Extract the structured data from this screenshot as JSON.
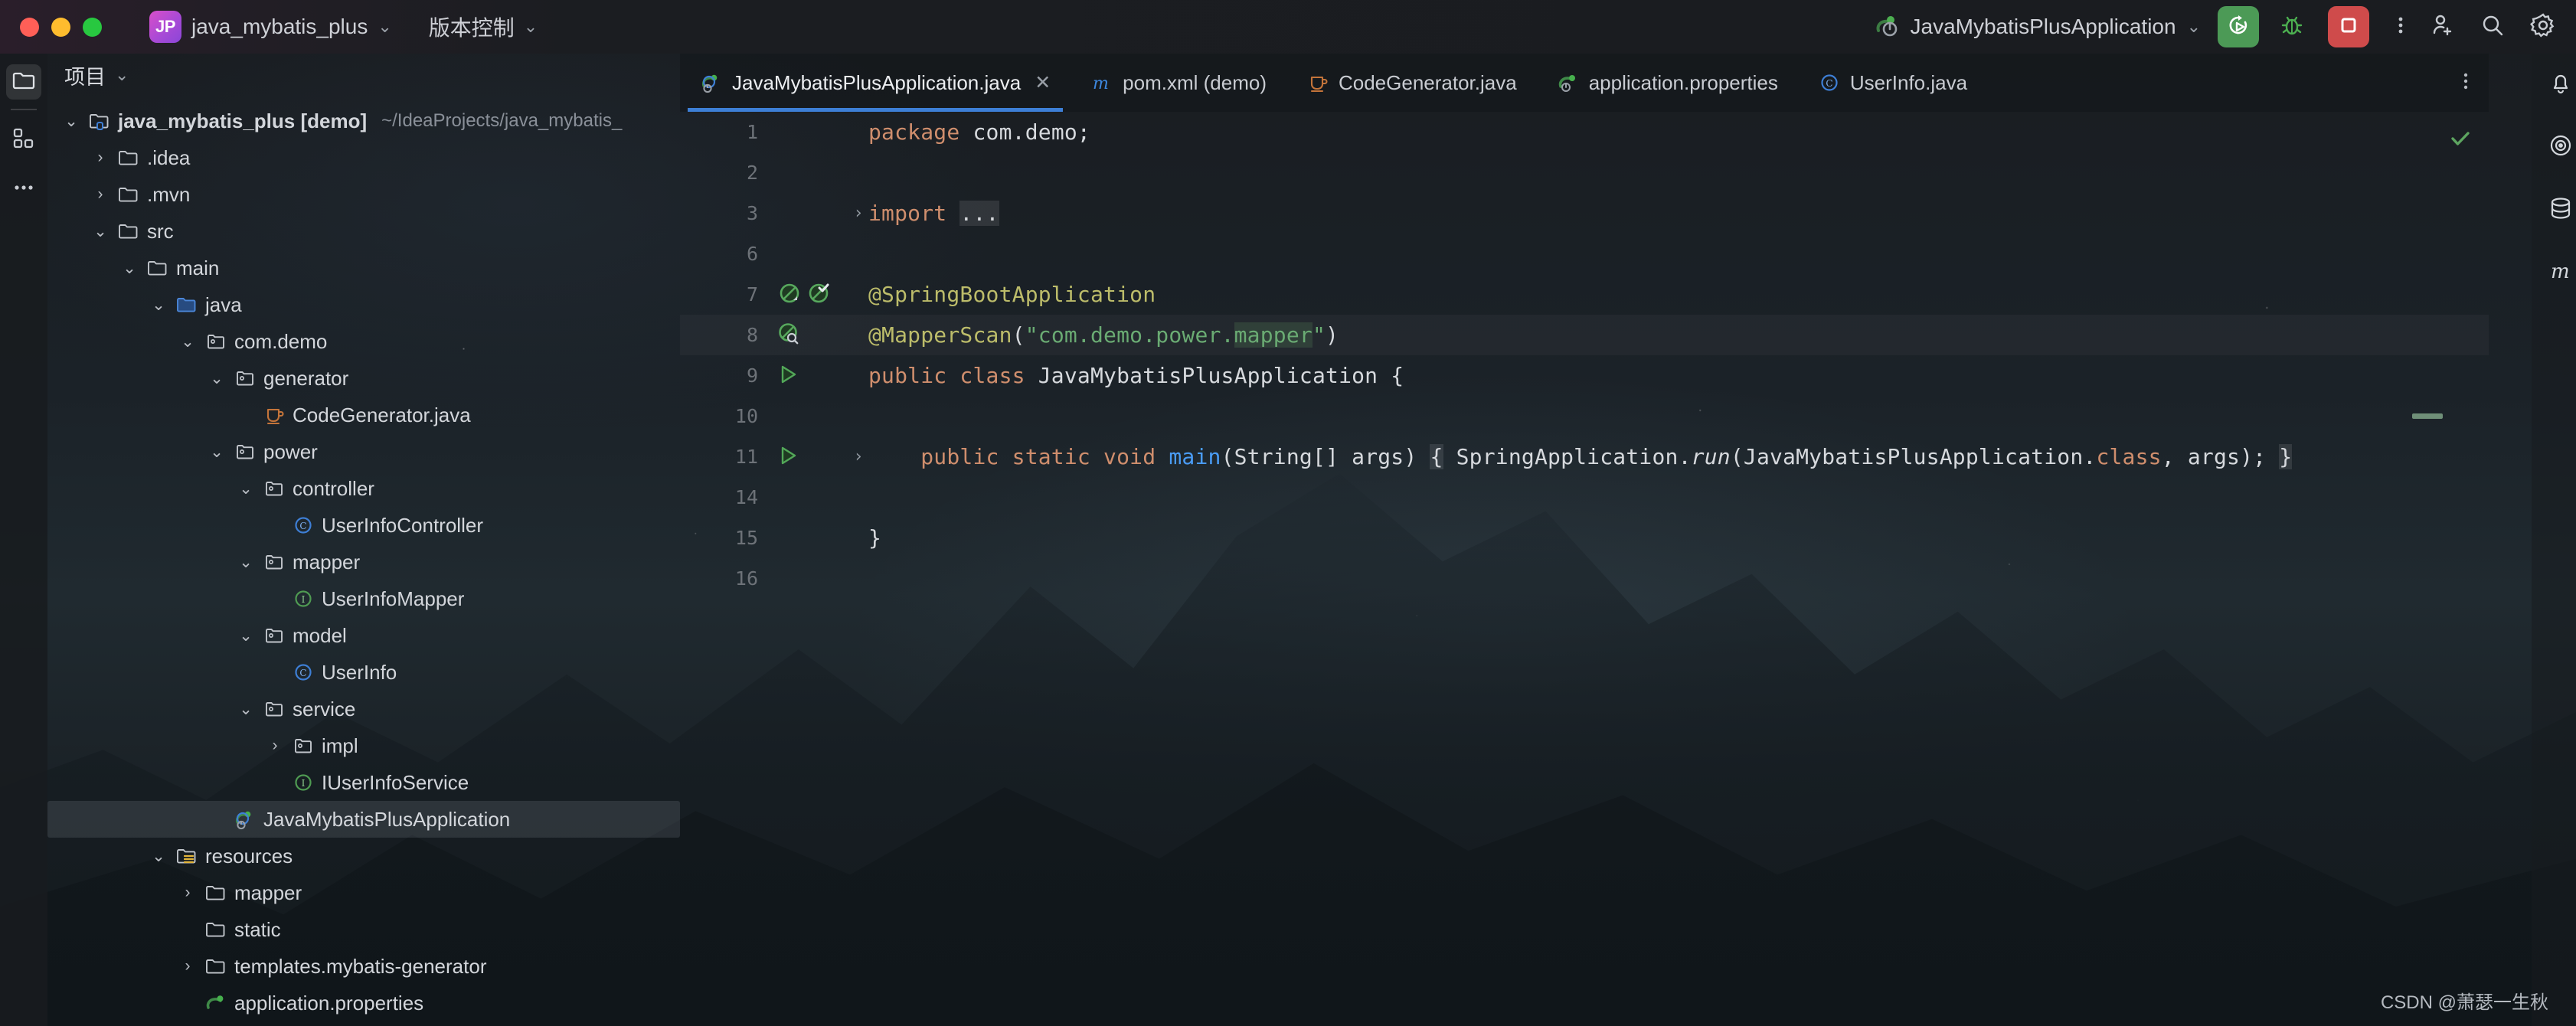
{
  "titlebar": {
    "project_badge": "JP",
    "project_name": "java_mybatis_plus",
    "project_chevron": "⌄",
    "vcs_label": "版本控制",
    "vcs_chevron": "⌄",
    "run_config_name": "JavaMybatisPlusApplication",
    "run_config_chevron": "⌄",
    "icons": {
      "run": "run-icon",
      "debug": "bug-icon",
      "stop": "stop-icon",
      "more": "more-vertical-icon",
      "add_user": "add-user-icon",
      "search": "search-icon",
      "settings": "gear-icon"
    },
    "accent_run_bg": "#4c9a56",
    "accent_stop_bg": "#cf4b4b",
    "accent_badge_bg": "#a94ad6"
  },
  "left_strip": {
    "items": [
      {
        "name": "project-tool-window",
        "icon": "folder-icon",
        "active": true
      },
      {
        "name": "commit-tool-window",
        "icon": "grid-squares-icon",
        "active": false
      },
      {
        "name": "more-tool-windows",
        "icon": "more-horizontal-icon",
        "active": false
      }
    ]
  },
  "project_panel": {
    "title": "项目",
    "title_chevron": "⌄",
    "tree": [
      {
        "label": "java_mybatis_plus [demo]",
        "path": "~/IdeaProjects/java_mybatis_",
        "depth": 0,
        "arrow": "⌄",
        "icon": "module-folder-icon",
        "bold": true,
        "selected": false
      },
      {
        "label": ".idea",
        "depth": 1,
        "arrow": "›",
        "icon": "folder-icon",
        "selected": false
      },
      {
        "label": ".mvn",
        "depth": 1,
        "arrow": "›",
        "icon": "folder-icon",
        "selected": false
      },
      {
        "label": "src",
        "depth": 1,
        "arrow": "⌄",
        "icon": "folder-icon",
        "selected": false
      },
      {
        "label": "main",
        "depth": 2,
        "arrow": "⌄",
        "icon": "folder-icon",
        "selected": false
      },
      {
        "label": "java",
        "depth": 3,
        "arrow": "⌄",
        "icon": "source-root-folder-icon",
        "selected": false
      },
      {
        "label": "com.demo",
        "depth": 4,
        "arrow": "⌄",
        "icon": "package-icon",
        "selected": false
      },
      {
        "label": "generator",
        "depth": 5,
        "arrow": "⌄",
        "icon": "package-icon",
        "selected": false
      },
      {
        "label": "CodeGenerator.java",
        "depth": 6,
        "arrow": "",
        "icon": "java-file-icon",
        "selected": false
      },
      {
        "label": "power",
        "depth": 5,
        "arrow": "⌄",
        "icon": "package-icon",
        "selected": false
      },
      {
        "label": "controller",
        "depth": 6,
        "arrow": "⌄",
        "icon": "package-icon",
        "selected": false
      },
      {
        "label": "UserInfoController",
        "depth": 7,
        "arrow": "",
        "icon": "class-icon",
        "selected": false
      },
      {
        "label": "mapper",
        "depth": 6,
        "arrow": "⌄",
        "icon": "package-icon",
        "selected": false
      },
      {
        "label": "UserInfoMapper",
        "depth": 7,
        "arrow": "",
        "icon": "interface-icon",
        "selected": false
      },
      {
        "label": "model",
        "depth": 6,
        "arrow": "⌄",
        "icon": "package-icon",
        "selected": false
      },
      {
        "label": "UserInfo",
        "depth": 7,
        "arrow": "",
        "icon": "class-icon",
        "selected": false
      },
      {
        "label": "service",
        "depth": 6,
        "arrow": "⌄",
        "icon": "package-icon",
        "selected": false
      },
      {
        "label": "impl",
        "depth": 7,
        "arrow": "›",
        "icon": "package-icon",
        "selected": false
      },
      {
        "label": "IUserInfoService",
        "depth": 7,
        "arrow": "",
        "icon": "interface-icon",
        "selected": false
      },
      {
        "label": "JavaMybatisPlusApplication",
        "depth": 5,
        "arrow": "",
        "icon": "spring-class-icon",
        "selected": true
      },
      {
        "label": "resources",
        "depth": 3,
        "arrow": "⌄",
        "icon": "resources-folder-icon",
        "selected": false
      },
      {
        "label": "mapper",
        "depth": 4,
        "arrow": "›",
        "icon": "folder-icon",
        "selected": false
      },
      {
        "label": "static",
        "depth": 4,
        "arrow": "",
        "icon": "folder-icon",
        "selected": false
      },
      {
        "label": "templates.mybatis-generator",
        "depth": 4,
        "arrow": "›",
        "icon": "folder-icon",
        "selected": false
      },
      {
        "label": "application.properties",
        "depth": 4,
        "arrow": "",
        "icon": "spring-properties-icon",
        "selected": false
      }
    ]
  },
  "editor": {
    "tabs": [
      {
        "label": "JavaMybatisPlusApplication.java",
        "icon": "spring-class-icon",
        "active": true,
        "closable": true,
        "close_glyph": "✕"
      },
      {
        "label": "pom.xml (demo)",
        "icon": "maven-icon",
        "active": false,
        "closable": false
      },
      {
        "label": "CodeGenerator.java",
        "icon": "java-file-icon",
        "active": false,
        "closable": false
      },
      {
        "label": "application.properties",
        "icon": "spring-leaf-icon",
        "active": false,
        "closable": false
      },
      {
        "label": "UserInfo.java",
        "icon": "class-icon",
        "active": false,
        "closable": false
      }
    ],
    "tabbar_more_icon": "more-vertical-icon",
    "inspection_status_icon": "checkmark-icon",
    "inspection_status_color": "#5da560",
    "lines": [
      {
        "num": "1",
        "gutter": [],
        "fold": "",
        "highlight": false,
        "tokens": [
          {
            "t": "package ",
            "c": "kw"
          },
          {
            "t": "com.demo;",
            "c": "txt"
          }
        ]
      },
      {
        "num": "2",
        "gutter": [],
        "fold": "",
        "highlight": false,
        "tokens": []
      },
      {
        "num": "3",
        "gutter": [],
        "fold": "›",
        "highlight": false,
        "tokens": [
          {
            "t": "import ",
            "c": "kw"
          },
          {
            "t": "...",
            "c": "txt hlbg"
          }
        ]
      },
      {
        "num": "6",
        "gutter": [],
        "fold": "",
        "highlight": false,
        "tokens": []
      },
      {
        "num": "7",
        "gutter": [
          "spring-bean-icon",
          "spring-bean-check-icon"
        ],
        "fold": "",
        "highlight": false,
        "tokens": [
          {
            "t": "@SpringBootApplication",
            "c": "ann"
          }
        ]
      },
      {
        "num": "8",
        "gutter": [
          "spring-bean-search-icon"
        ],
        "fold": "",
        "highlight": true,
        "tokens": [
          {
            "t": "@MapperScan",
            "c": "ann"
          },
          {
            "t": "(",
            "c": "txt"
          },
          {
            "t": "\"com.demo.power.",
            "c": "str"
          },
          {
            "t": "mapper",
            "c": "str hlgrn"
          },
          {
            "t": "\"",
            "c": "str"
          },
          {
            "t": ")",
            "c": "txt"
          }
        ]
      },
      {
        "num": "9",
        "gutter": [
          "run-gutter-icon"
        ],
        "fold": "",
        "highlight": false,
        "tokens": [
          {
            "t": "public class ",
            "c": "kw"
          },
          {
            "t": "JavaMybatisPlusApplication {",
            "c": "txt"
          }
        ]
      },
      {
        "num": "10",
        "gutter": [],
        "fold": "",
        "highlight": false,
        "tokens": []
      },
      {
        "num": "11",
        "gutter": [
          "run-gutter-icon"
        ],
        "fold": "›",
        "highlight": false,
        "tokens": [
          {
            "t": "    public static void ",
            "c": "kw"
          },
          {
            "t": "main",
            "c": "mth"
          },
          {
            "t": "(String[] args) ",
            "c": "txt"
          },
          {
            "t": "{",
            "c": "txt hlbg"
          },
          {
            "t": " SpringApplication.",
            "c": "txt"
          },
          {
            "t": "run",
            "c": "ital"
          },
          {
            "t": "(JavaMybatisPlusApplication.",
            "c": "txt"
          },
          {
            "t": "class",
            "c": "kw"
          },
          {
            "t": ", args); ",
            "c": "txt"
          },
          {
            "t": "}",
            "c": "txt hlbg"
          }
        ]
      },
      {
        "num": "14",
        "gutter": [],
        "fold": "",
        "highlight": false,
        "tokens": []
      },
      {
        "num": "15",
        "gutter": [],
        "fold": "",
        "highlight": false,
        "tokens": [
          {
            "t": "}",
            "c": "txt"
          }
        ]
      },
      {
        "num": "16",
        "gutter": [],
        "fold": "",
        "highlight": false,
        "tokens": []
      }
    ]
  },
  "right_strip": {
    "items": [
      {
        "name": "notifications",
        "icon": "bell-icon"
      },
      {
        "name": "ai-assistant",
        "icon": "assistant-icon"
      },
      {
        "name": "database",
        "icon": "database-icon"
      },
      {
        "name": "maven",
        "icon": "maven-icon"
      }
    ]
  },
  "watermark": "CSDN @萧瑟一生秋"
}
